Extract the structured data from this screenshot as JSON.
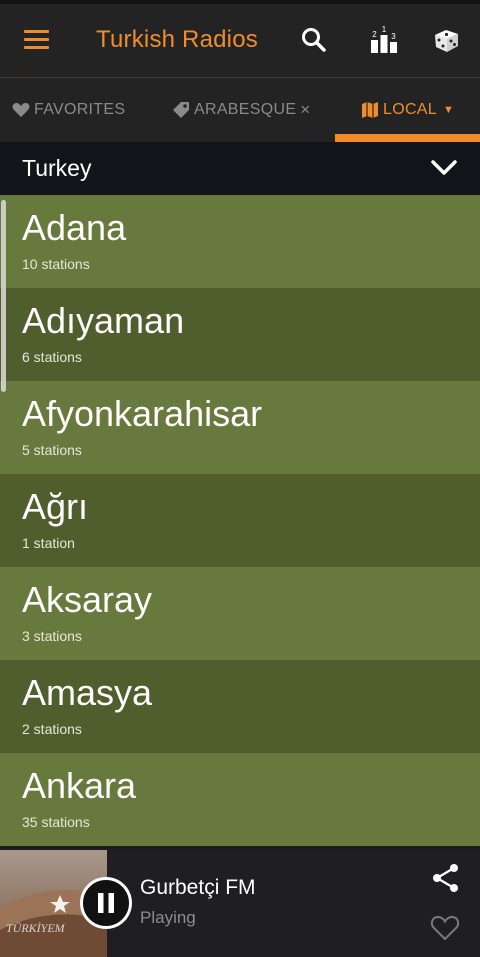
{
  "app": {
    "title": "Turkish Radios"
  },
  "toolbar": {
    "icons": [
      "menu-icon",
      "search-icon",
      "ranking-icon",
      "dice-icon"
    ],
    "ranking_digits": [
      "2",
      "1",
      "3"
    ]
  },
  "tabs": [
    {
      "label": "FAVORITES",
      "icon": "heart-icon"
    },
    {
      "label": "ARABESQUE",
      "icon": "tag-icon",
      "close": "×"
    },
    {
      "label": "LOCAL",
      "icon": "map-icon",
      "dropdown": "▼"
    }
  ],
  "region": {
    "selected": "Turkey"
  },
  "cities": [
    {
      "name": "Adana",
      "count": "10 stations"
    },
    {
      "name": "Adıyaman",
      "count": "6 stations"
    },
    {
      "name": "Afyonkarahisar",
      "count": "5 stations"
    },
    {
      "name": "Ağrı",
      "count": "1 station"
    },
    {
      "name": "Aksaray",
      "count": "3 stations"
    },
    {
      "name": "Amasya",
      "count": "2 stations"
    },
    {
      "name": "Ankara",
      "count": "35 stations"
    }
  ],
  "player": {
    "station": "Gurbetçi FM",
    "status": "Playing",
    "art_text": "TÜRKİYEM"
  },
  "colors": {
    "accent": "#f08d2a",
    "row_light": "#68793d",
    "row_dark": "#4f5e2c",
    "toolbar_bg": "#232323"
  }
}
